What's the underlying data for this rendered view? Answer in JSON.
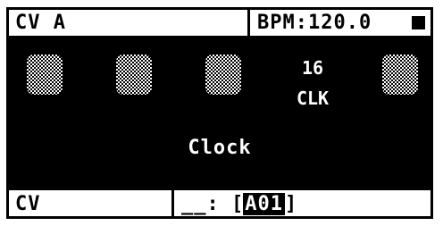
{
  "header": {
    "title": "CV A",
    "bpm": "BPM:120.0"
  },
  "main": {
    "slot_number": "16",
    "slot_label": "CLK",
    "center_label": "Clock"
  },
  "footer": {
    "mode": "CV",
    "slot_prefix": "__:",
    "bracket_open": "[",
    "slot_value": "A01",
    "bracket_close": "]"
  },
  "colors": {
    "background": "#000000",
    "foreground": "#ffffff"
  },
  "icons": {
    "status": "stop-square-icon",
    "pad": "checkered-pad-icon"
  }
}
